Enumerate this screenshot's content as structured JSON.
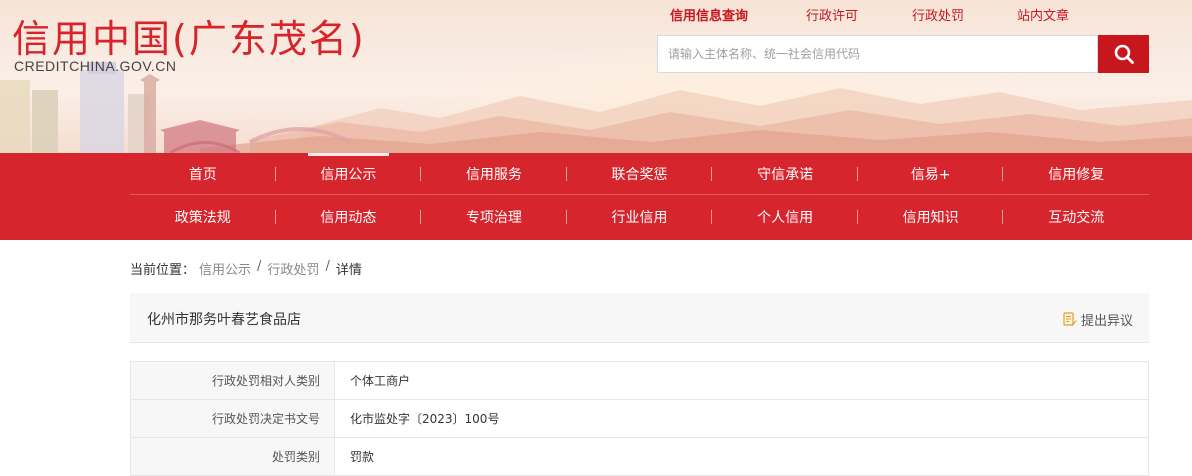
{
  "brand": {
    "logo_cn": "信用中国(广东茂名)",
    "logo_en": "CREDITCHINA.GOV.CN"
  },
  "top_links": [
    {
      "label": "信用信息查询",
      "active": true
    },
    {
      "label": "行政许可",
      "active": false
    },
    {
      "label": "行政处罚",
      "active": false
    },
    {
      "label": "站内文章",
      "active": false
    }
  ],
  "search": {
    "placeholder": "请输入主体名称、统一社会信用代码",
    "icon": "search-icon"
  },
  "nav": {
    "row1": [
      "首页",
      "信用公示",
      "信用服务",
      "联合奖惩",
      "守信承诺",
      "信易+",
      "信用修复"
    ],
    "row2": [
      "政策法规",
      "信用动态",
      "专项治理",
      "行业信用",
      "个人信用",
      "信用知识",
      "互动交流"
    ],
    "current": "信用公示"
  },
  "breadcrumb": {
    "prefix": "当前位置：",
    "items": [
      "信用公示",
      "行政处罚",
      "详情"
    ],
    "separator": "/"
  },
  "subject": {
    "name": "化州市那务叶春艺食品店",
    "objection_label": "提出异议",
    "objection_icon": "document-edit-icon"
  },
  "details": [
    {
      "key": "行政处罚相对人类别",
      "value": "个体工商户"
    },
    {
      "key": "行政处罚决定书文号",
      "value": "化市监处字〔2023〕100号"
    },
    {
      "key": "处罚类别",
      "value": "罚款"
    }
  ],
  "colors": {
    "brand_red": "#d6252c",
    "link_red": "#c8161d"
  }
}
